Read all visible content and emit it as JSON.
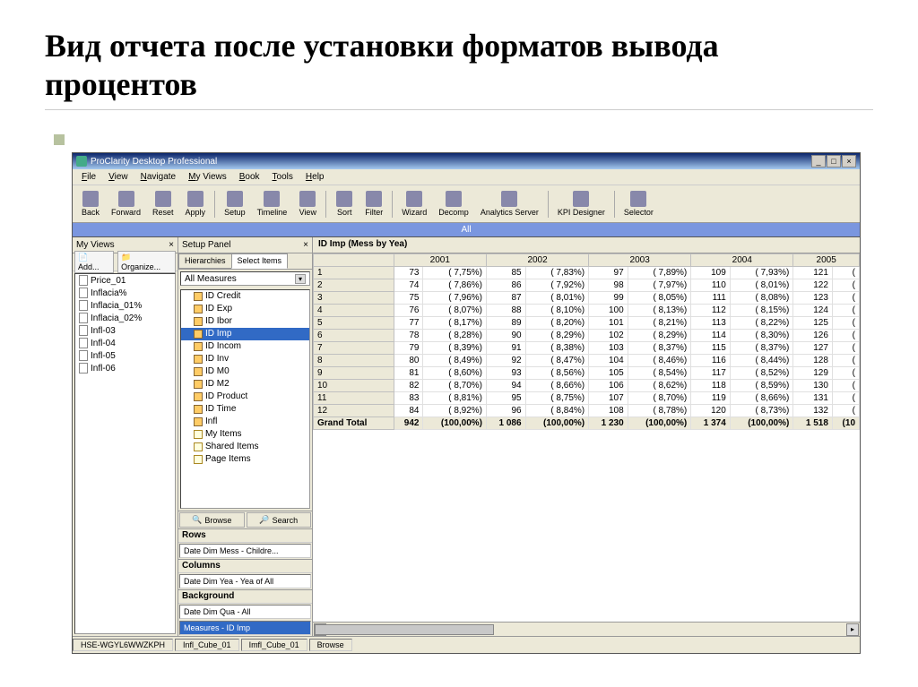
{
  "slide_title": "Вид отчета после установки форматов вывода процентов",
  "app_title": "ProClarity Desktop Professional",
  "menu": [
    "File",
    "View",
    "Navigate",
    "My Views",
    "Book",
    "Tools",
    "Help"
  ],
  "toolbar": [
    {
      "label": "Back"
    },
    {
      "label": "Forward"
    },
    {
      "label": "Reset"
    },
    {
      "label": "Apply"
    },
    {
      "sep": true
    },
    {
      "label": "Setup"
    },
    {
      "label": "Timeline"
    },
    {
      "label": "View"
    },
    {
      "sep": true
    },
    {
      "label": "Sort"
    },
    {
      "label": "Filter"
    },
    {
      "sep": true
    },
    {
      "label": "Wizard"
    },
    {
      "label": "Decomp"
    },
    {
      "label": "Analytics Server"
    },
    {
      "sep": true
    },
    {
      "label": "KPI Designer"
    },
    {
      "sep": true
    },
    {
      "label": "Selector"
    }
  ],
  "all_label": "All",
  "myviews": {
    "title": "My Views",
    "add": "Add...",
    "organize": "Organize...",
    "items": [
      "Price_01",
      "Inflacia%",
      "Inflacia_01%",
      "Inflacia_02%",
      "Infl-03",
      "Infl-04",
      "Infl-05",
      "Infl-06"
    ]
  },
  "setup": {
    "title": "Setup Panel",
    "tabs": [
      "Hierarchies",
      "Select Items"
    ],
    "combo": "All Measures",
    "tree": [
      "ID Credit",
      "ID Exp",
      "ID Ibor",
      "ID Imp",
      "ID Incom",
      "ID Inv",
      "ID M0",
      "ID M2",
      "ID Product",
      "ID Time",
      "Infl",
      "My Items",
      "Shared Items",
      "Page Items"
    ],
    "selected": "ID Imp",
    "browse": "Browse",
    "search": "Search",
    "rows_hdr": "Rows",
    "rows_val": "Date Dim Mess - Childre...",
    "cols_hdr": "Columns",
    "cols_val": "Date Dim Yea - Yea of All",
    "bg_hdr": "Background",
    "bg_vals": [
      "Date Dim Qua - All",
      "Measures - ID Imp"
    ]
  },
  "grid": {
    "title": "ID Imp (Mess by Yea)",
    "years": [
      "2001",
      "2002",
      "2003",
      "2004",
      "2005"
    ],
    "row_labels": [
      "1",
      "2",
      "3",
      "4",
      "5",
      "6",
      "7",
      "8",
      "9",
      "10",
      "11",
      "12"
    ],
    "total_label": "Grand Total",
    "data": [
      [
        [
          "73",
          "( 7,75%)"
        ],
        [
          "85",
          "( 7,83%)"
        ],
        [
          "97",
          "( 7,89%)"
        ],
        [
          "109",
          "( 7,93%)"
        ],
        [
          "121",
          "("
        ]
      ],
      [
        [
          "74",
          "( 7,86%)"
        ],
        [
          "86",
          "( 7,92%)"
        ],
        [
          "98",
          "( 7,97%)"
        ],
        [
          "110",
          "( 8,01%)"
        ],
        [
          "122",
          "("
        ]
      ],
      [
        [
          "75",
          "( 7,96%)"
        ],
        [
          "87",
          "( 8,01%)"
        ],
        [
          "99",
          "( 8,05%)"
        ],
        [
          "111",
          "( 8,08%)"
        ],
        [
          "123",
          "("
        ]
      ],
      [
        [
          "76",
          "( 8,07%)"
        ],
        [
          "88",
          "( 8,10%)"
        ],
        [
          "100",
          "( 8,13%)"
        ],
        [
          "112",
          "( 8,15%)"
        ],
        [
          "124",
          "("
        ]
      ],
      [
        [
          "77",
          "( 8,17%)"
        ],
        [
          "89",
          "( 8,20%)"
        ],
        [
          "101",
          "( 8,21%)"
        ],
        [
          "113",
          "( 8,22%)"
        ],
        [
          "125",
          "("
        ]
      ],
      [
        [
          "78",
          "( 8,28%)"
        ],
        [
          "90",
          "( 8,29%)"
        ],
        [
          "102",
          "( 8,29%)"
        ],
        [
          "114",
          "( 8,30%)"
        ],
        [
          "126",
          "("
        ]
      ],
      [
        [
          "79",
          "( 8,39%)"
        ],
        [
          "91",
          "( 8,38%)"
        ],
        [
          "103",
          "( 8,37%)"
        ],
        [
          "115",
          "( 8,37%)"
        ],
        [
          "127",
          "("
        ]
      ],
      [
        [
          "80",
          "( 8,49%)"
        ],
        [
          "92",
          "( 8,47%)"
        ],
        [
          "104",
          "( 8,46%)"
        ],
        [
          "116",
          "( 8,44%)"
        ],
        [
          "128",
          "("
        ]
      ],
      [
        [
          "81",
          "( 8,60%)"
        ],
        [
          "93",
          "( 8,56%)"
        ],
        [
          "105",
          "( 8,54%)"
        ],
        [
          "117",
          "( 8,52%)"
        ],
        [
          "129",
          "("
        ]
      ],
      [
        [
          "82",
          "( 8,70%)"
        ],
        [
          "94",
          "( 8,66%)"
        ],
        [
          "106",
          "( 8,62%)"
        ],
        [
          "118",
          "( 8,59%)"
        ],
        [
          "130",
          "("
        ]
      ],
      [
        [
          "83",
          "( 8,81%)"
        ],
        [
          "95",
          "( 8,75%)"
        ],
        [
          "107",
          "( 8,70%)"
        ],
        [
          "119",
          "( 8,66%)"
        ],
        [
          "131",
          "("
        ]
      ],
      [
        [
          "84",
          "( 8,92%)"
        ],
        [
          "96",
          "( 8,84%)"
        ],
        [
          "108",
          "( 8,78%)"
        ],
        [
          "120",
          "( 8,73%)"
        ],
        [
          "132",
          "("
        ]
      ]
    ],
    "total": [
      [
        "942",
        "(100,00%)"
      ],
      [
        "1 086",
        "(100,00%)"
      ],
      [
        "1 230",
        "(100,00%)"
      ],
      [
        "1 374",
        "(100,00%)"
      ],
      [
        "1 518",
        "(10"
      ]
    ]
  },
  "status": [
    "HSE-WGYL6WWZKPH",
    "Infl_Cube_01",
    "Imfl_Cube_01",
    "Browse"
  ]
}
